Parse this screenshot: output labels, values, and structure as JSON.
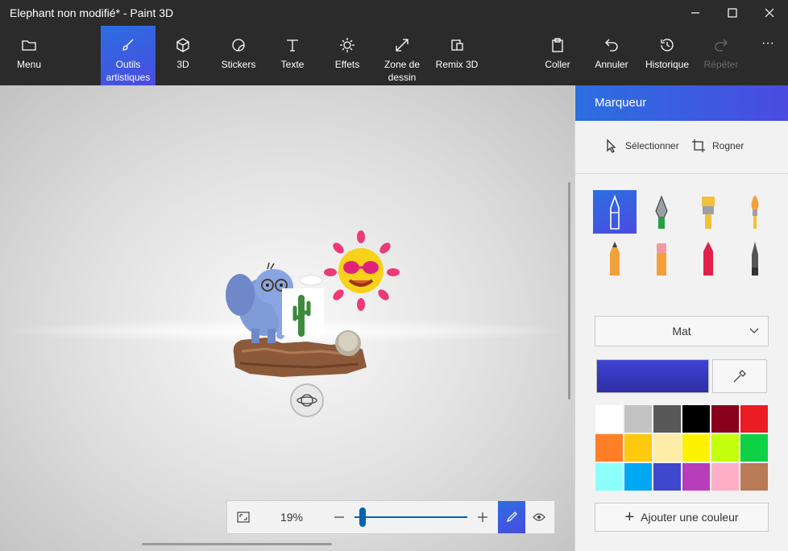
{
  "window": {
    "title": "Elephant non modifié* - Paint 3D"
  },
  "toolbar": {
    "menu": "Menu",
    "brushes": "Outils\nartistiques",
    "three_d": "3D",
    "stickers": "Stickers",
    "text": "Texte",
    "effects": "Effets",
    "canvas": "Zone de\ndessin",
    "remix": "Remix 3D",
    "paste": "Coller",
    "undo": "Annuler",
    "history": "Historique",
    "redo": "Répéter",
    "more": "···"
  },
  "zoom": {
    "value": "19%",
    "level": 0.07
  },
  "panel": {
    "title": "Marqueur",
    "select": "Sélectionner",
    "crop": "Rogner",
    "finish": "Mat",
    "add_color": "Ajouter une couleur",
    "current_color": "#3a3dc8",
    "palette": [
      "#ffffff",
      "#c3c3c3",
      "#585858",
      "#000000",
      "#88001b",
      "#ec1c24",
      "#ff7f27",
      "#ffc90e",
      "#fdeca6",
      "#fff200",
      "#c4ff0e",
      "#0ed145",
      "#8cfffb",
      "#00a8f3",
      "#3f48cc",
      "#b83dba",
      "#ffaec8",
      "#b97a56"
    ]
  }
}
